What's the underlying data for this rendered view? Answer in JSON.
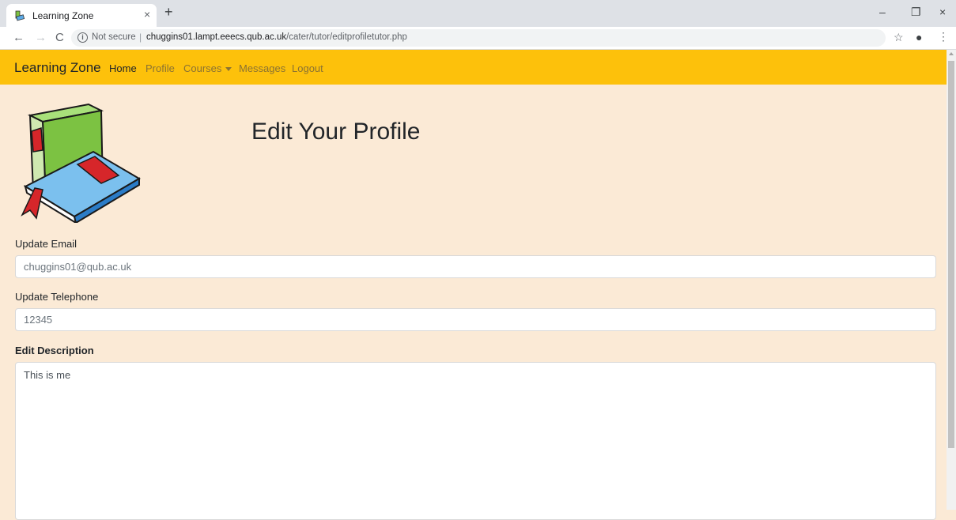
{
  "browser": {
    "tab_title": "Learning Zone",
    "tab_close": "×",
    "new_tab": "+",
    "security_label": "Not secure",
    "url_host": "chuggins01.lampt.eeecs.qub.ac.uk",
    "url_path": "/cater/tutor/editprofiletutor.php",
    "window_controls": {
      "minimize": "–",
      "maximize": "❐",
      "close": "×"
    }
  },
  "navbar": {
    "brand": "Learning Zone",
    "links": [
      "Home",
      "Profile",
      "Courses",
      "Messages",
      "Logout"
    ],
    "active": "Home",
    "color": "#fdc10b"
  },
  "page": {
    "title": "Edit Your Profile",
    "background": "#fbead6"
  },
  "form": {
    "email_label": "Update Email",
    "email_value": "chuggins01@qub.ac.uk",
    "telephone_label": "Update Telephone",
    "telephone_value": "12345",
    "description_label": "Edit Description",
    "description_value": "This is me"
  },
  "icons": {
    "favicon": "books-icon",
    "logo": "books-logo"
  }
}
